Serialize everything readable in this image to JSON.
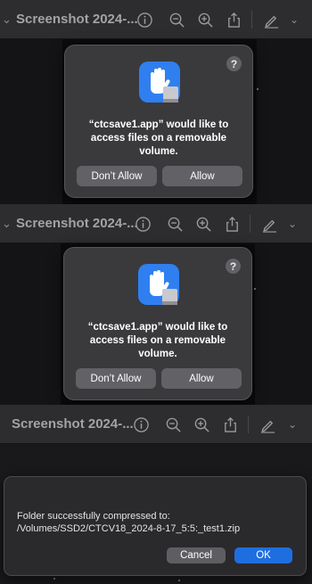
{
  "panels": [
    {
      "title": "Screenshot 2024-...",
      "dialog": {
        "message": "“ctcsave1.app” would like to access files on a removable volume.",
        "help": "?",
        "deny_label": "Don’t Allow",
        "allow_label": "Allow"
      }
    },
    {
      "title": "Screenshot 2024-...",
      "dialog": {
        "message": "“ctcsave1.app” would like to access files on a removable volume.",
        "help": "?",
        "deny_label": "Don’t Allow",
        "allow_label": "Allow"
      }
    },
    {
      "title": "Screenshot 2024-...",
      "alert": {
        "message": "Folder successfully compressed to: /Volumes/SSD2/CTCV18_2024-8-17_5:5:_test1.zip",
        "cancel_label": "Cancel",
        "ok_label": "OK"
      }
    }
  ],
  "icons": [
    "chevron-down-icon",
    "info-icon",
    "zoom-out-icon",
    "zoom-in-icon",
    "share-icon",
    "markup-pen-icon",
    "hand-stop-icon",
    "drive-icon"
  ],
  "colors": {
    "accent": "#1f6ee0",
    "app_icon": "#2f7ff0",
    "dialog_bg": "#3a3a3c",
    "toolbar_bg": "#2d2d2f"
  }
}
